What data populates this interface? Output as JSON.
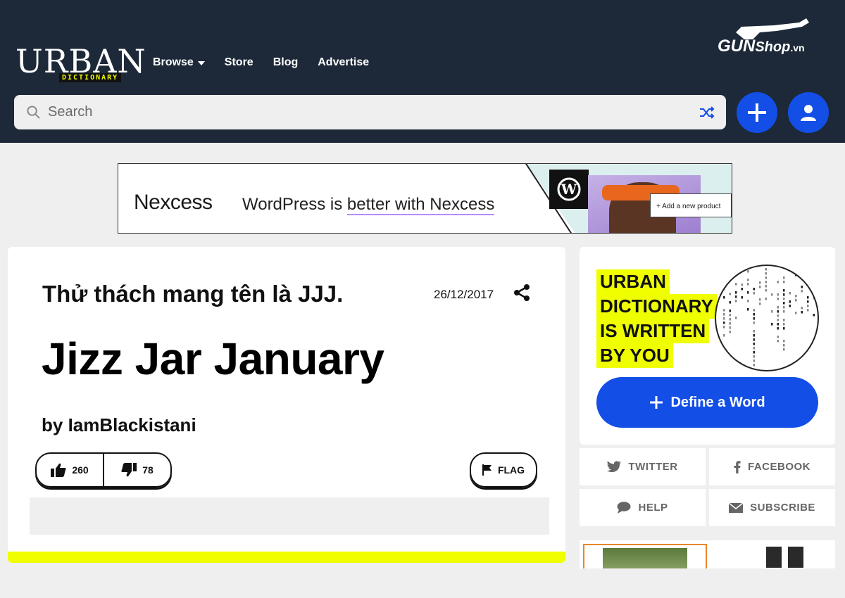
{
  "header": {
    "logo_text": "URBAN",
    "logo_sub": "DICTIONARY",
    "nav": [
      {
        "label": "Browse"
      },
      {
        "label": "Store"
      },
      {
        "label": "Blog"
      },
      {
        "label": "Advertise"
      }
    ],
    "watermark_main": "GUN",
    "watermark_sub": "Shop",
    "watermark_tld": ".vn",
    "search": {
      "placeholder": "Search"
    }
  },
  "ad": {
    "brand": "Nexcess",
    "text_prefix": "WordPress is ",
    "text_highlight": "better with Nexcess",
    "card_text": "+ Add a new product"
  },
  "entry": {
    "meaning": "Thử thách mang tên là JJJ.",
    "date": "26/12/2017",
    "word": "Jizz Jar January",
    "author_prefix": "by ",
    "author": "IamBlackistani",
    "upvotes": "260",
    "downvotes": "78",
    "flag_label": "FLAG"
  },
  "sidebar": {
    "promo_lines": [
      "URBAN",
      "DICTIONARY",
      "IS WRITTEN",
      "BY YOU"
    ],
    "define_label": "Define a Word",
    "social": [
      {
        "label": "TWITTER",
        "icon": "twitter-icon"
      },
      {
        "label": "FACEBOOK",
        "icon": "facebook-icon"
      },
      {
        "label": "HELP",
        "icon": "chat-icon"
      },
      {
        "label": "SUBSCRIBE",
        "icon": "mail-icon"
      }
    ]
  },
  "colors": {
    "header_bg": "#1d2939",
    "accent_blue": "#134fe6",
    "highlight_yellow": "#efff00",
    "page_bg": "#efefef"
  }
}
